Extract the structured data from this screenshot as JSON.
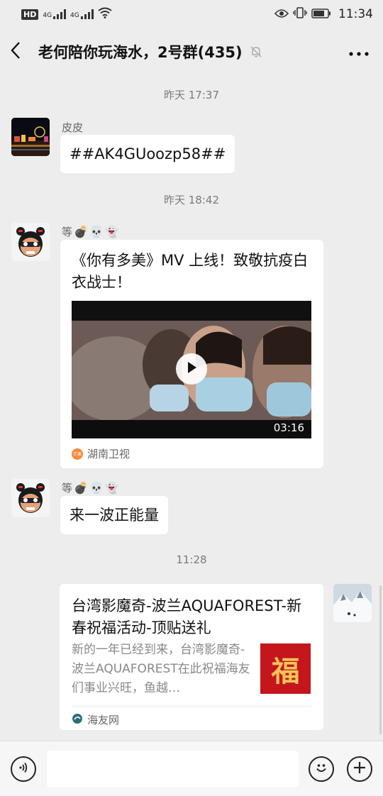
{
  "status_bar": {
    "hd_label": "HD",
    "signal1_label": "4G",
    "signal2_label": "4G",
    "time": "11:34"
  },
  "header": {
    "back_icon": "chevron-left-icon",
    "title": "老何陪你玩海水，2号群(435)",
    "mute_icon": "bell-off-icon",
    "more_icon": "more-dots-icon"
  },
  "messages": [
    {
      "type": "timestamp",
      "text": "昨天 17:37"
    },
    {
      "type": "text",
      "sender": "皮皮",
      "text": "##AK4GUoozp58##"
    },
    {
      "type": "timestamp",
      "text": "昨天 18:42"
    },
    {
      "type": "video-card",
      "sender": "等",
      "sender_emojis": [
        "💣",
        "💀",
        "👻"
      ],
      "title": "《你有多美》MV 上线！致敬抗疫白衣战士！",
      "duration": "03:16",
      "source": "湖南卫视",
      "source_icon_text": "芒果"
    },
    {
      "type": "text",
      "sender": "等",
      "sender_emojis": [
        "💣",
        "💀",
        "👻"
      ],
      "text": "来一波正能量"
    },
    {
      "type": "timestamp",
      "text": "11:28"
    },
    {
      "type": "article-card",
      "title": "台湾影魔奇-波兰AQUAFOREST-新春祝福活动-顶贴送礼",
      "description": "新的一年已经到来，台湾影魔奇-波兰AQUAFOREST在此祝福海友们事业兴旺，鱼越…",
      "thumb_text": "福",
      "source": "海友网"
    }
  ],
  "input_bar": {
    "voice_icon": "voice-icon",
    "emoji_icon": "emoji-icon",
    "plus_icon": "plus-icon",
    "input_value": ""
  }
}
